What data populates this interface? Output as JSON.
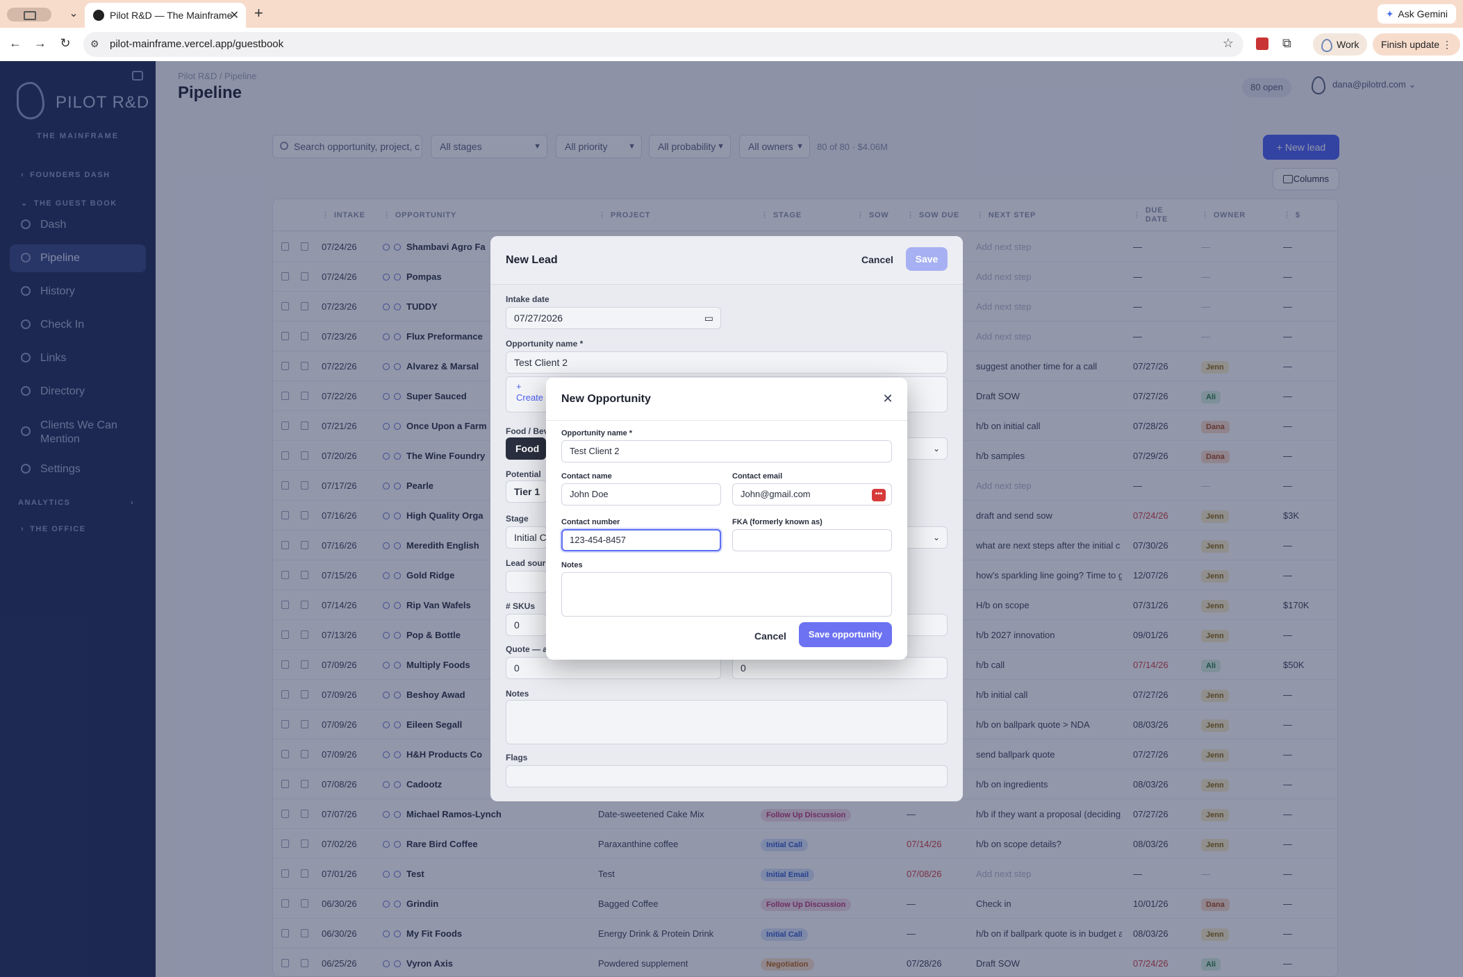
{
  "browser": {
    "tab_title": "Pilot R&D — The Mainframe",
    "url": "pilot-mainframe.vercel.app/guestbook",
    "gemini_label": "Ask Gemini",
    "profile_label": "Work",
    "update_label": "Finish update"
  },
  "sidebar": {
    "brand": "PILOT R&D",
    "brand_sub": "THE MAINFRAME",
    "sections": {
      "founders": "FOUNDERS DASH",
      "guestbook": "THE GUEST BOOK",
      "analytics": "ANALYTICS",
      "office": "THE OFFICE"
    },
    "items": [
      {
        "label": "Dash"
      },
      {
        "label": "Pipeline"
      },
      {
        "label": "History"
      },
      {
        "label": "Check In"
      },
      {
        "label": "Links"
      },
      {
        "label": "Directory"
      },
      {
        "label": "Clients We Can Mention"
      },
      {
        "label": "Settings"
      }
    ]
  },
  "header": {
    "breadcrumb": "Pilot R&D / Pipeline",
    "title": "Pipeline",
    "open_badge": "80 open",
    "user_email": "dana@pilotrd.com"
  },
  "filters": {
    "search_placeholder": "Search opportunity, project, c",
    "stage": "All stages",
    "priority": "All priority",
    "probability": "All probability",
    "owners": "All owners",
    "count": "80 of 80 · $4.06M",
    "new_lead": "+ New lead",
    "columns": "Columns"
  },
  "table": {
    "columns": [
      "INTAKE",
      "OPPORTUNITY",
      "PROJECT",
      "STAGE",
      "SOW",
      "SOW DUE",
      "NEXT STEP",
      "DUE DATE",
      "OWNER",
      "$"
    ],
    "rows": [
      {
        "intake": "07/24/26",
        "opp": "Shambavi Agro Fa",
        "project": "",
        "stage": "",
        "sow_due": "",
        "next": "Add next step",
        "due": "—",
        "owner": "",
        "amount": "—"
      },
      {
        "intake": "07/24/26",
        "opp": "Pompas",
        "project": "",
        "stage": "",
        "sow_due": "",
        "next": "Add next step",
        "due": "—",
        "owner": "",
        "amount": "—"
      },
      {
        "intake": "07/23/26",
        "opp": "TUDDY",
        "project": "",
        "stage": "",
        "sow_due": "",
        "next": "Add next step",
        "due": "—",
        "owner": "",
        "amount": "—"
      },
      {
        "intake": "07/23/26",
        "opp": "Flux Preformance",
        "project": "",
        "stage": "",
        "sow_due": "",
        "next": "Add next step",
        "due": "—",
        "owner": "",
        "amount": "—"
      },
      {
        "intake": "07/22/26",
        "opp": "Alvarez & Marsal",
        "project": "",
        "stage": "",
        "sow_due": "",
        "next": "suggest another time for a call",
        "due": "07/27/26",
        "owner": "Jenn",
        "amount": "—"
      },
      {
        "intake": "07/22/26",
        "opp": "Super Sauced",
        "project": "",
        "stage": "",
        "sow_due": "",
        "next": "Draft SOW",
        "due": "07/27/26",
        "owner": "Ali",
        "amount": "—"
      },
      {
        "intake": "07/21/26",
        "opp": "Once Upon a Farm",
        "project": "",
        "stage": "",
        "sow_due": "",
        "next": "h/b on initial call",
        "due": "07/28/26",
        "owner": "Dana",
        "amount": "—"
      },
      {
        "intake": "07/20/26",
        "opp": "The Wine Foundry",
        "project": "",
        "stage": "",
        "sow_due": "",
        "next": "h/b samples",
        "due": "07/29/26",
        "owner": "Dana",
        "amount": "—"
      },
      {
        "intake": "07/17/26",
        "opp": "Pearle",
        "project": "",
        "stage": "",
        "sow_due": "",
        "next": "Add next step",
        "due": "—",
        "owner": "",
        "amount": "—"
      },
      {
        "intake": "07/16/26",
        "opp": "High Quality Orga",
        "project": "",
        "stage": "",
        "sow_due": "",
        "next": "draft and send sow",
        "due": "07/24/26",
        "owner": "Jenn",
        "amount": "$3K"
      },
      {
        "intake": "07/16/26",
        "opp": "Meredith English",
        "project": "",
        "stage": "",
        "sow_due": "",
        "next": "what are next steps after the initial c",
        "due": "07/30/26",
        "owner": "Jenn",
        "amount": "—"
      },
      {
        "intake": "07/15/26",
        "opp": "Gold Ridge",
        "project": "",
        "stage": "",
        "sow_due": "",
        "next": "how's sparkling line going? Time to g",
        "due": "12/07/26",
        "owner": "Jenn",
        "amount": "—"
      },
      {
        "intake": "07/14/26",
        "opp": "Rip Van Wafels",
        "project": "",
        "stage": "",
        "sow_due": "",
        "next": "H/b on scope",
        "due": "07/31/26",
        "owner": "Jenn",
        "amount": "$170K"
      },
      {
        "intake": "07/13/26",
        "opp": "Pop & Bottle",
        "project": "",
        "stage": "",
        "sow_due": "",
        "next": "h/b 2027 innovation",
        "due": "09/01/26",
        "owner": "Jenn",
        "amount": "—"
      },
      {
        "intake": "07/09/26",
        "opp": "Multiply Foods",
        "project": "",
        "stage": "",
        "sow_due": "",
        "next": "h/b call",
        "due": "07/14/26",
        "owner": "Ali",
        "amount": "$50K"
      },
      {
        "intake": "07/09/26",
        "opp": "Beshoy Awad",
        "project": "",
        "stage": "",
        "sow_due": "",
        "next": "h/b initial call",
        "due": "07/27/26",
        "owner": "Jenn",
        "amount": "—"
      },
      {
        "intake": "07/09/26",
        "opp": "Eileen Segall",
        "project": "",
        "stage": "",
        "sow_due": "",
        "next": "h/b on ballpark quote > NDA",
        "due": "08/03/26",
        "owner": "Jenn",
        "amount": "—"
      },
      {
        "intake": "07/09/26",
        "opp": "H&H Products Co",
        "project": "",
        "stage": "",
        "sow_due": "",
        "next": "send ballpark quote",
        "due": "07/27/26",
        "owner": "Jenn",
        "amount": "—"
      },
      {
        "intake": "07/08/26",
        "opp": "Cadootz",
        "project": "",
        "stage": "",
        "sow_due": "",
        "next": "h/b on ingredients",
        "due": "08/03/26",
        "owner": "Jenn",
        "amount": "—"
      },
      {
        "intake": "07/07/26",
        "opp": "Michael Ramos-Lynch",
        "project": "Date-sweetened Cake Mix",
        "stage": "Follow Up Discussion",
        "sow_due": "—",
        "next": "h/b if they want a proposal (deciding",
        "due": "07/27/26",
        "owner": "Jenn",
        "amount": "—"
      },
      {
        "intake": "07/02/26",
        "opp": "Rare Bird Coffee",
        "project": "Paraxanthine coffee",
        "stage": "Initial Call",
        "sow_due": "07/14/26",
        "next": "h/b on scope details?",
        "due": "08/03/26",
        "owner": "Jenn",
        "amount": "—"
      },
      {
        "intake": "07/01/26",
        "opp": "Test",
        "project": "Test",
        "stage": "Initial Email",
        "sow_due": "07/08/26",
        "next": "Add next step",
        "due": "—",
        "owner": "",
        "amount": "—"
      },
      {
        "intake": "06/30/26",
        "opp": "Grindin",
        "project": "Bagged Coffee",
        "stage": "Follow Up Discussion",
        "sow_due": "—",
        "next": "Check in",
        "due": "10/01/26",
        "owner": "Dana",
        "amount": "—"
      },
      {
        "intake": "06/30/26",
        "opp": "My Fit Foods",
        "project": "Energy Drink & Protein Drink",
        "stage": "Initial Call",
        "sow_due": "—",
        "next": "h/b on if ballpark quote is in budget a",
        "due": "08/03/26",
        "owner": "Jenn",
        "amount": "—"
      },
      {
        "intake": "06/25/26",
        "opp": "Vyron Axis",
        "project": "Powdered supplement",
        "stage": "Negotiation",
        "sow_due": "07/28/26",
        "next": "Draft SOW",
        "due": "07/24/26",
        "owner": "Ali",
        "amount": "—"
      }
    ],
    "placeholder_dash": "—"
  },
  "new_lead": {
    "title": "New Lead",
    "cancel": "Cancel",
    "save": "Save",
    "intake_label": "Intake date",
    "intake_value": "07/27/2026",
    "opp_label": "Opportunity name *",
    "opp_value": "Test Client 2",
    "create_plus": "+",
    "create_text": "Create",
    "food_label": "Food / Bev",
    "food_value": "Food",
    "potential_label": "Potential",
    "potential_value": "Tier 1",
    "stage_label": "Stage",
    "stage_value": "Initial C",
    "lead_source_label": "Lead sourc",
    "skus_label": "# SKUs",
    "skus_value": "0",
    "quote_label": "Quote — ac",
    "quote_value": "0",
    "quote_value2": "0",
    "notes_label": "Notes",
    "flags_label": "Flags"
  },
  "modal": {
    "title": "New Opportunity",
    "opp_label": "Opportunity name *",
    "opp_value": "Test Client 2",
    "contact_name_label": "Contact name",
    "contact_name_value": "John Doe",
    "contact_email_label": "Contact email",
    "contact_email_value": "John@gmail.com",
    "contact_number_label": "Contact number",
    "contact_number_value": "123-454-8457",
    "fka_label": "FKA (formerly known as)",
    "notes_label": "Notes",
    "cancel": "Cancel",
    "save": "Save opportunity"
  },
  "colors": {
    "sidebar_bg": "#1f2b57",
    "accent": "#4a5ff0",
    "modal_primary": "#6d72f2",
    "chrome_bg": "#f7dccc"
  }
}
